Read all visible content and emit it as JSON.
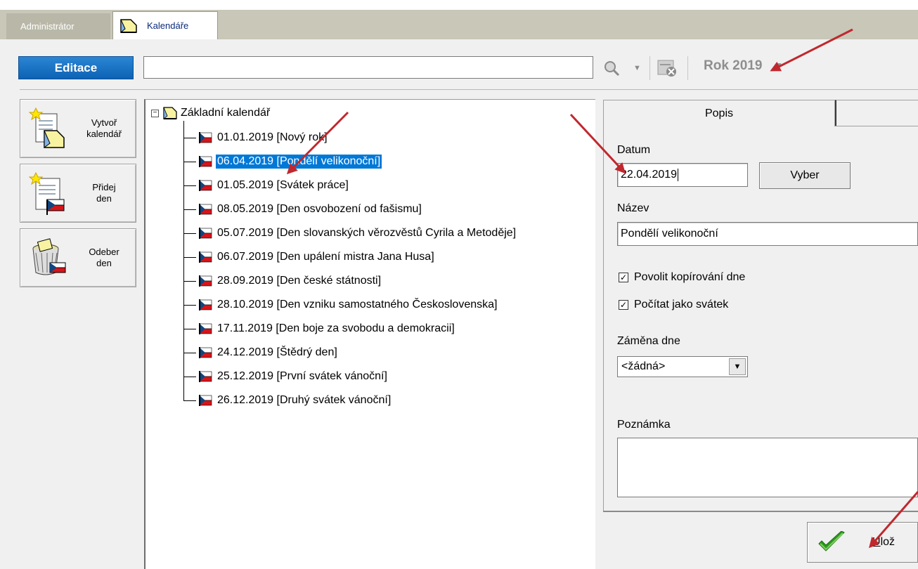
{
  "tabs": {
    "admin_label": "Administrátor",
    "calendars_label": "Kalendáře"
  },
  "toolbar": {
    "edit_label": "Editace",
    "search_value": "",
    "year_label": "Rok 2019"
  },
  "actions": {
    "create_calendar": "Vytvoř\nkalendář",
    "add_day": "Přidej\nden",
    "remove_day": "Odeber\nden"
  },
  "tree": {
    "root_label": "Základní kalendář",
    "items": [
      "01.01.2019 [Nový rok]",
      "06.04.2019 [Pondělí velikonoční]",
      "01.05.2019 [Svátek práce]",
      "08.05.2019 [Den osvobození od fašismu]",
      "05.07.2019 [Den slovanských věrozvěstů Cyrila a Metoděje]",
      "06.07.2019 [Den upálení mistra Jana Husa]",
      "28.09.2019 [Den české státnosti]",
      "28.10.2019 [Den vzniku samostatného Československa]",
      "17.11.2019 [Den boje za svobodu a demokracii]",
      "24.12.2019 [Štědrý den]",
      "25.12.2019 [První svátek vánoční]",
      "26.12.2019 [Druhý svátek vánoční]"
    ],
    "selected_index": 1
  },
  "detail": {
    "tab_label": "Popis",
    "date_label": "Datum",
    "date_value": "22.04.2019",
    "pick_button": "Vyber",
    "name_label": "Název",
    "name_value": "Pondělí velikonoční",
    "allow_copy_label": "Povolit kopírování dne",
    "allow_copy_checked": true,
    "count_holiday_label": "Počítat jako svátek",
    "count_holiday_checked": true,
    "swap_label": "Záměna dne",
    "swap_value": "<žádná>",
    "note_label": "Poznámka",
    "note_value": "",
    "save_label_first": "U",
    "save_label_rest": "lož"
  },
  "colors": {
    "edit_button": "#0d62b4",
    "selection": "#0078d7",
    "annotation_arrow": "#c0282e",
    "tabbar": "#c8c7b8"
  }
}
